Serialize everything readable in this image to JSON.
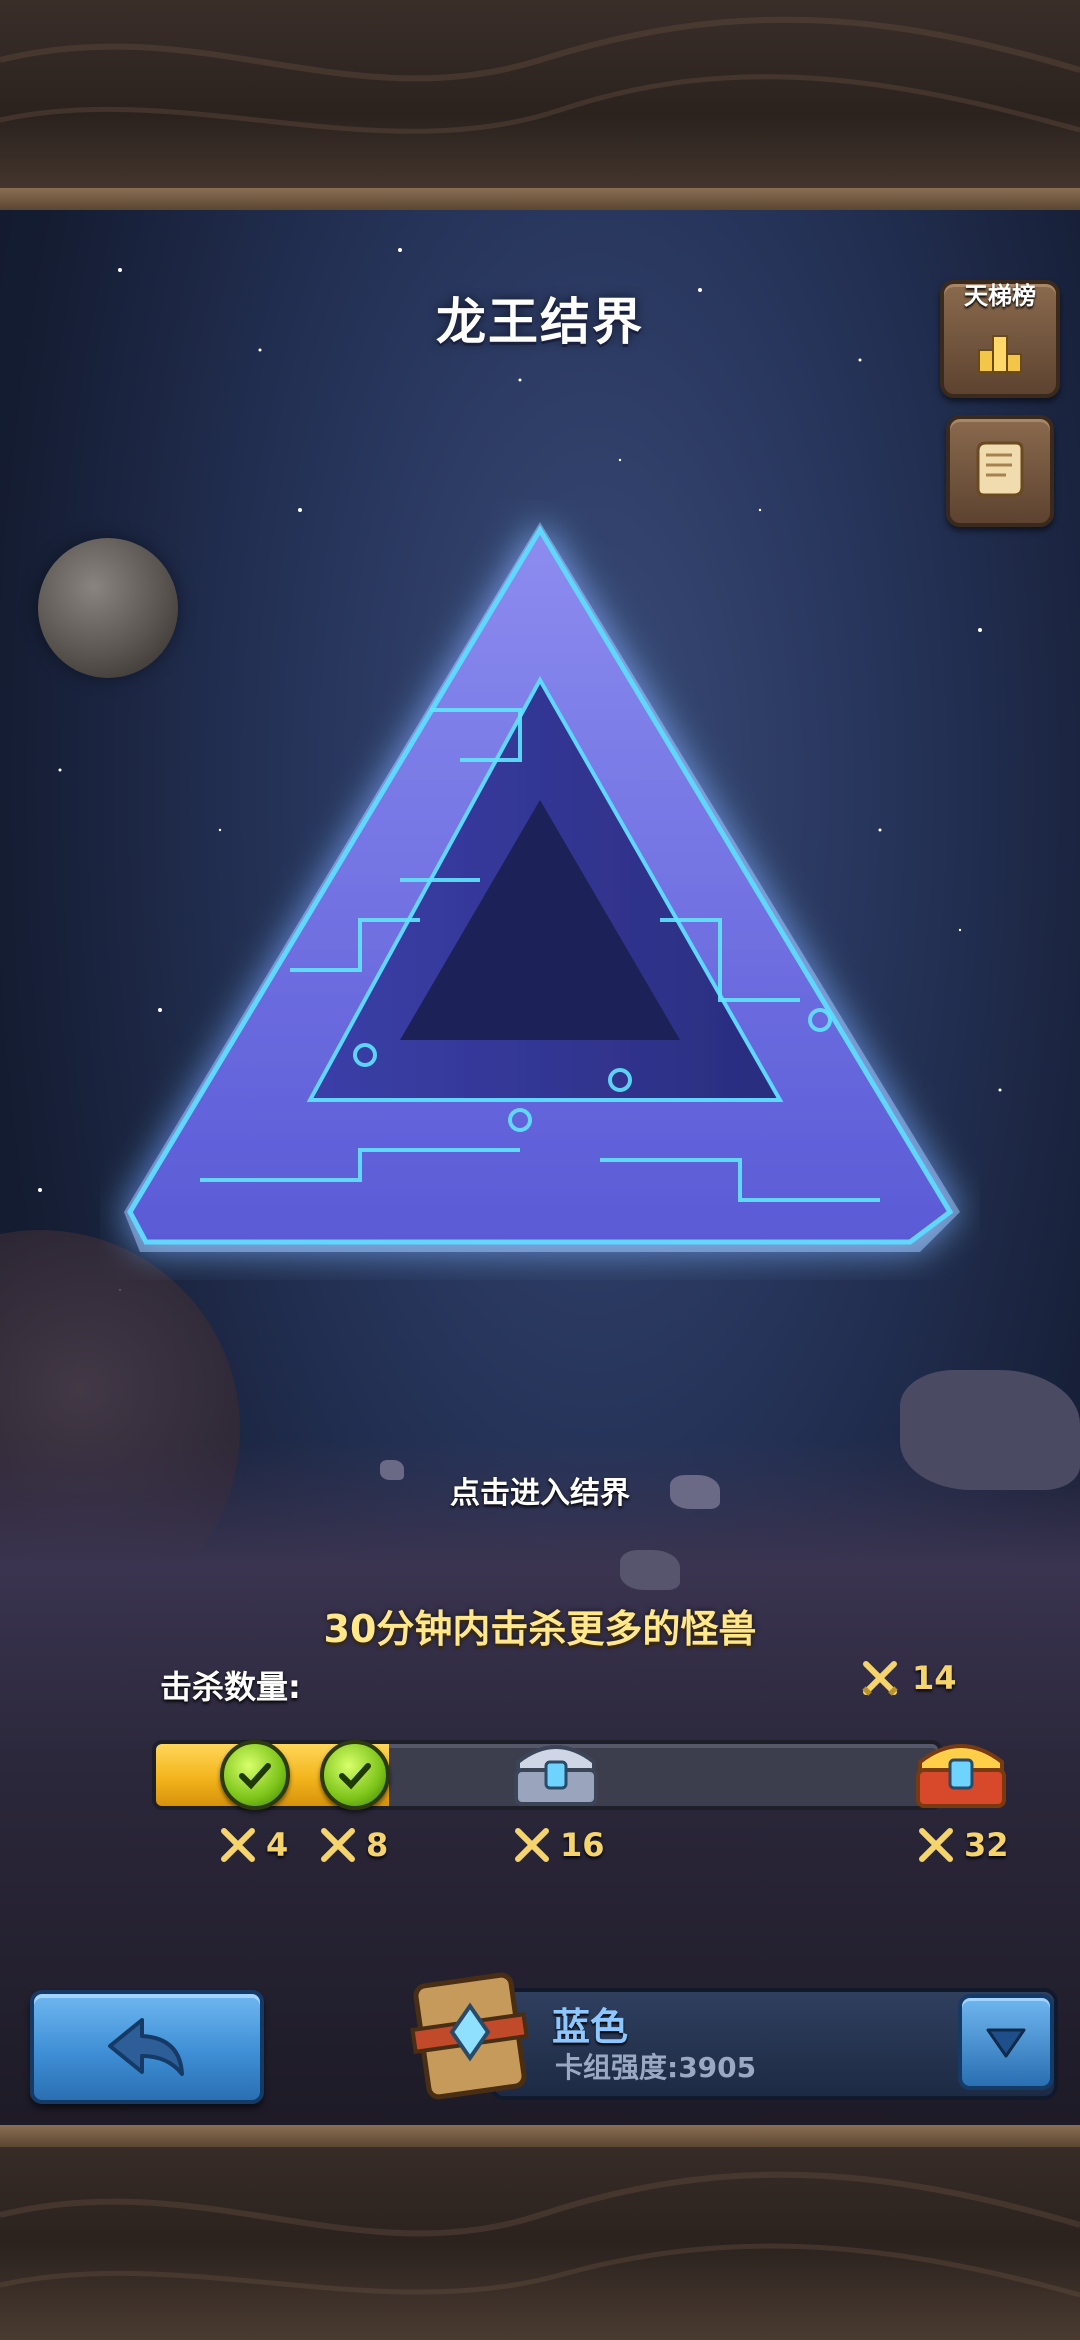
{
  "header": {
    "title": "龙王结界",
    "ladder_label": "天梯榜"
  },
  "icons": {
    "ladder": "podium-icon",
    "scroll": "scroll-icon",
    "back": "back-arrow-icon",
    "dropdown": "chevron-down-icon",
    "kills": "crossed-swords-icon"
  },
  "main": {
    "enter_hint": "点击进入结界",
    "goal": "30分钟内击杀更多的怪兽",
    "kill_label": "击杀数量:",
    "kill_count": "14"
  },
  "progress": {
    "max": 32,
    "current": 14,
    "milestones": [
      {
        "kills": "4",
        "value": 4,
        "reward": "check",
        "claimed": true
      },
      {
        "kills": "8",
        "value": 8,
        "reward": "check",
        "claimed": true
      },
      {
        "kills": "16",
        "value": 16,
        "reward": "silver-chest",
        "claimed": false
      },
      {
        "kills": "32",
        "value": 32,
        "reward": "gold-chest",
        "claimed": false
      }
    ]
  },
  "deck": {
    "name": "蓝色",
    "power": "卡组强度:3905"
  },
  "colors": {
    "accent_gold": "#f5d46b",
    "bar_fill": "#f3b51c",
    "button_blue": "#3f8fd6",
    "deck_name": "#8cc8ff"
  }
}
